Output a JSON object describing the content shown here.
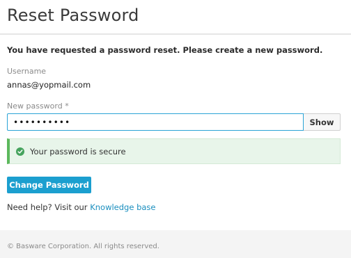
{
  "header": {
    "title": "Reset Password"
  },
  "intro": "You have requested a password reset. Please create a new password.",
  "username": {
    "label": "Username",
    "value": "annas@yopmail.com"
  },
  "new_password": {
    "label": "New password *",
    "value": "••••••••••",
    "show_label": "Show"
  },
  "alert": {
    "icon": "check-circle-icon",
    "text": "Your password is secure"
  },
  "submit": {
    "label": "Change Password"
  },
  "help": {
    "prefix": "Need help? Visit our ",
    "link_text": "Knowledge base"
  },
  "footer": {
    "text": "© Basware Corporation. All rights reserved."
  },
  "colors": {
    "accent": "#1b9fcf",
    "success": "#5cb85c",
    "success_bg": "#e8f5ea",
    "link": "#1b8fbf"
  }
}
